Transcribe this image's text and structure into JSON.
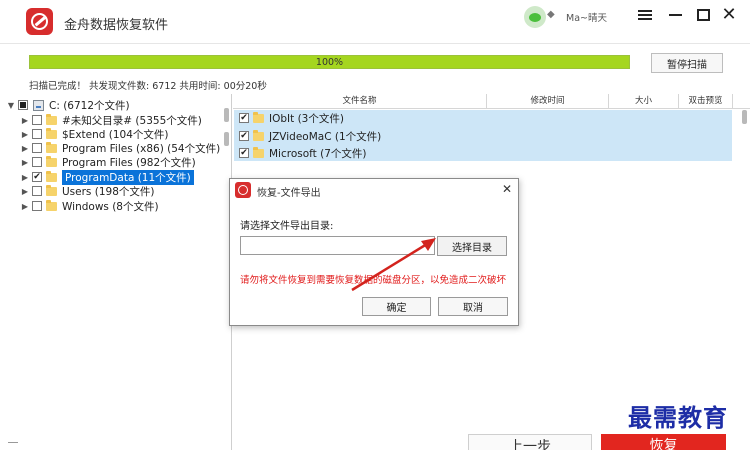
{
  "app": {
    "title": "金舟数据恢复软件",
    "user_name": "Ma~晴天",
    "brand_color": "#d72d2d"
  },
  "icons": {
    "logo": "app-logo-icon",
    "wechat": "wechat-icon",
    "gem": "diamond-icon",
    "menu": "hamburger-menu-icon",
    "minimize": "minimize-icon",
    "maximize": "maximize-icon",
    "close": "close-icon"
  },
  "scan": {
    "progress_percent": 100,
    "progress_label": "100%",
    "pause_button": "暂停扫描",
    "status": "扫描已完成！ 共发现文件数: 6712   共用时间: 00分20秒",
    "progress_color": "#a5d61f"
  },
  "tree": {
    "root": {
      "label": "C:  (6712个文件)"
    },
    "items": [
      {
        "label": "#未知父目录#  (5355个文件)",
        "checked": false
      },
      {
        "label": "$Extend  (104个文件)",
        "checked": false
      },
      {
        "label": "Program Files (x86)  (54个文件)",
        "checked": false
      },
      {
        "label": "Program Files  (982个文件)",
        "checked": false
      },
      {
        "label": "ProgramData  (11个文件)",
        "checked": true,
        "selected": true
      },
      {
        "label": "Users  (198个文件)",
        "checked": false
      },
      {
        "label": "Windows  (8个文件)",
        "checked": false
      }
    ]
  },
  "columns": {
    "name": "文件名称",
    "modified": "修改时间",
    "size": "大小",
    "preview": "双击预览"
  },
  "files": [
    {
      "name": "IObIt   (3个文件)",
      "checked": true
    },
    {
      "name": "JZVideoMaC   (1个文件)",
      "checked": true
    },
    {
      "name": "Microsoft   (7个文件)",
      "checked": true
    }
  ],
  "dialog": {
    "title": "恢复-文件导出",
    "prompt": "请选择文件导出目录:",
    "path_value": "",
    "browse_button": "选择目录",
    "warning": "请勿将文件恢复到需要恢复数据的磁盘分区，以免造成二次破坏",
    "ok_button": "确定",
    "cancel_button": "取消",
    "warning_color": "#e11a1a"
  },
  "bottom": {
    "prev_button": "上一步",
    "recover_button": "恢复"
  },
  "watermark": "最需教育"
}
